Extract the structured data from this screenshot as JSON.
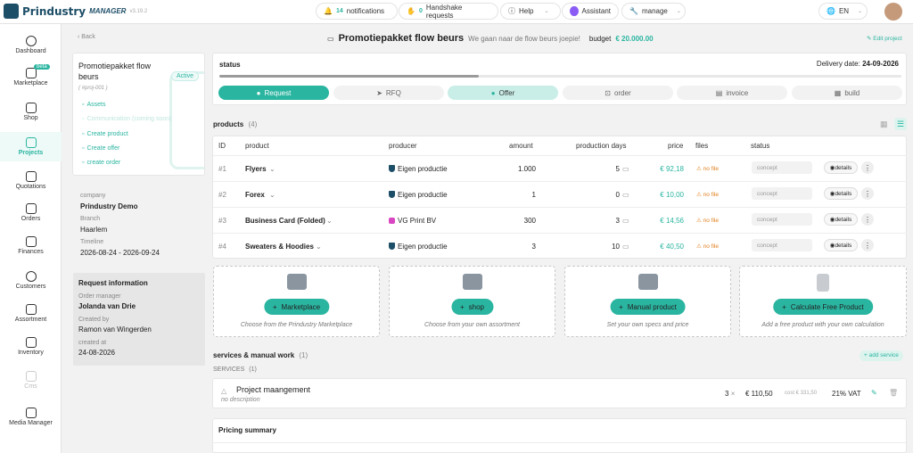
{
  "topbar": {
    "brand": "Prindustry",
    "brand_sub": "MANAGER",
    "version": "v3.19.2",
    "notifications": {
      "count": "14",
      "label": "notifications"
    },
    "handshake": {
      "count": "0",
      "label": "Handshake requests"
    },
    "help_label": "Help",
    "assistant_label": "Assistant",
    "manage_label": "manage",
    "language": "EN"
  },
  "sidebar": {
    "beta_badge": "beta",
    "items": [
      {
        "label": "Dashboard"
      },
      {
        "label": "Marketplace"
      },
      {
        "label": "Shop"
      },
      {
        "label": "Projects"
      },
      {
        "label": "Quotations"
      },
      {
        "label": "Orders"
      },
      {
        "label": "Finances"
      },
      {
        "label": "Customers"
      },
      {
        "label": "Assortment"
      },
      {
        "label": "Inventory"
      },
      {
        "label": "Cms"
      },
      {
        "label": "Media Manager"
      }
    ]
  },
  "header": {
    "back_label": "Back",
    "title": "Promotiepakket flow beurs",
    "subtitle": "We gaan naar de flow beurs joepie!",
    "budget_label": "budget",
    "budget_value": "€ 20.000.00",
    "edit_label": "Edit project"
  },
  "project_card": {
    "name": "Promotiepakket flow beurs",
    "id": "( #proj-001 )",
    "status": "Active",
    "links": [
      "Assets",
      "Communication (coming soon)",
      "Create product",
      "Create offer",
      "create order"
    ]
  },
  "company_info": {
    "company_label": "company",
    "company": "Prindustry Demo",
    "branch_label": "Branch",
    "branch": "Haarlem",
    "timeline_label": "Timeline",
    "timeline": "2026-08-24 - 2026-09-24"
  },
  "request_info": {
    "title": "Request information",
    "order_manager_label": "Order manager",
    "order_manager": "Jolanda van Drie",
    "created_by_label": "Created by",
    "created_by": "Ramon van Wingerden",
    "created_at_label": "created at",
    "created_at": "24-08-2026"
  },
  "status": {
    "title": "status",
    "delivery_label": "Delivery date:",
    "delivery_date": "24-09-2026",
    "progress": 0.38,
    "steps": [
      {
        "label": "Request",
        "state": "done"
      },
      {
        "label": "RFQ",
        "state": "todo"
      },
      {
        "label": "Offer",
        "state": "current"
      },
      {
        "label": "order",
        "state": "todo"
      },
      {
        "label": "invoice",
        "state": "todo"
      },
      {
        "label": "build",
        "state": "todo"
      }
    ]
  },
  "products": {
    "title": "products",
    "count": "(4)",
    "columns": [
      "ID",
      "product",
      "producer",
      "amount",
      "production days",
      "price",
      "files",
      "status"
    ],
    "rows": [
      {
        "id": "#1",
        "product": "Flyers",
        "producer": "Eigen productie",
        "producer_type": "own",
        "amount": "1.000",
        "days": "5",
        "price": "€ 92,18",
        "files": "no file",
        "status": "concept",
        "details": "details"
      },
      {
        "id": "#2",
        "product": "Forex",
        "producer": "Eigen productie",
        "producer_type": "own",
        "amount": "1",
        "days": "0",
        "price": "€ 10,00",
        "files": "no file",
        "status": "concept",
        "details": "details"
      },
      {
        "id": "#3",
        "product": "Business Card (Folded)",
        "producer": "VG Print BV",
        "producer_type": "vg",
        "amount": "300",
        "days": "3",
        "price": "€ 14,56",
        "files": "no file",
        "status": "concept",
        "details": "details"
      },
      {
        "id": "#4",
        "product": "Sweaters & Hoodies",
        "producer": "Eigen productie",
        "producer_type": "own",
        "amount": "3",
        "days": "10",
        "price": "€ 40,50",
        "files": "no file",
        "status": "concept",
        "details": "details"
      }
    ]
  },
  "add_boxes": [
    {
      "button": "Marketplace",
      "caption": "Choose from the Prindustry Marketplace"
    },
    {
      "button": "shop",
      "caption": "Choose from your own assortment"
    },
    {
      "button": "Manual product",
      "caption": "Set your own specs and price"
    },
    {
      "button": "Calculate Free Product",
      "caption": "Add a free product with your own calculation"
    }
  ],
  "services": {
    "title": "services & manual work",
    "count": "(1)",
    "add_label": "add service",
    "section_label": "SERVICES",
    "section_count": "(1)",
    "item": {
      "name": "Project maangement",
      "desc": "no description",
      "qty": "3",
      "price": "€ 110,50",
      "cost": "cost € 331,50",
      "vat": "21% VAT"
    }
  },
  "pricing": {
    "title": "Pricing summary"
  }
}
